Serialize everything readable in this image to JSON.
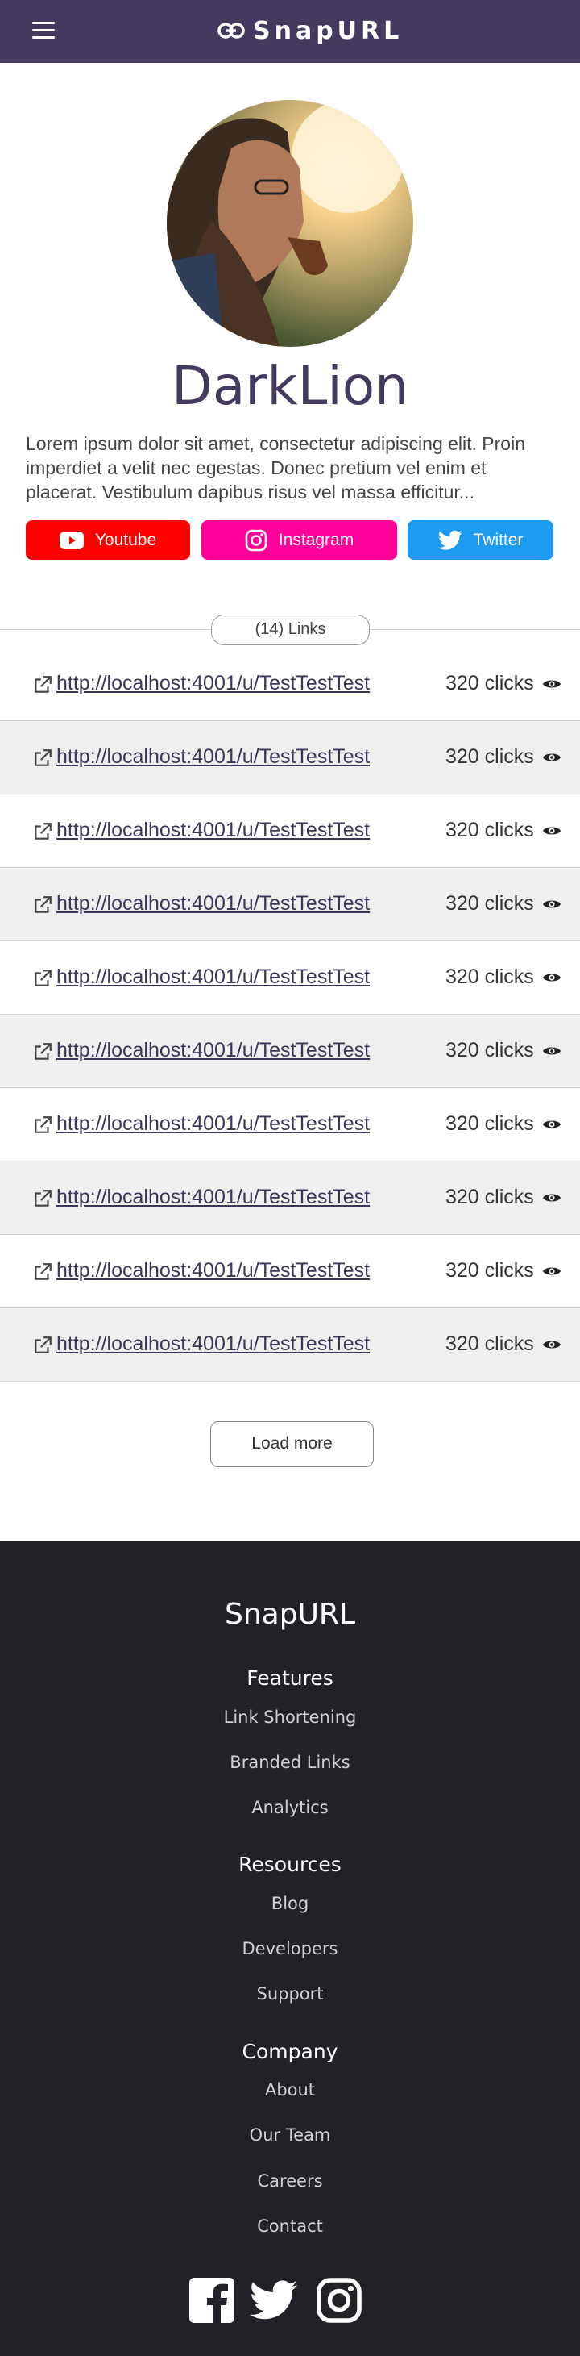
{
  "header": {
    "brand": "SnapURL",
    "menu_icon": "hamburger-menu-icon",
    "brand_icon": "link-icon",
    "background_color": "#44395f"
  },
  "profile": {
    "username": "DarkLion",
    "bio": "Lorem ipsum dolor sit amet, consectetur adipiscing elit. Proin imperdiet a velit nec egestas. Donec pretium vel enim et placerat. Vestibulum dapibus risus vel massa efficitur...",
    "socials": [
      {
        "label": "Youtube",
        "icon": "youtube-icon",
        "color": "#ff0000"
      },
      {
        "label": "Instagram",
        "icon": "instagram-icon",
        "color": "#ff0099"
      },
      {
        "label": "Twitter",
        "icon": "twitter-icon",
        "color": "#1d9bf0"
      }
    ]
  },
  "links": {
    "count_label": "(14) Links",
    "items": [
      {
        "url": "http://localhost:4001/u/TestTestTest",
        "clicks": "320 clicks"
      },
      {
        "url": "http://localhost:4001/u/TestTestTest",
        "clicks": "320 clicks"
      },
      {
        "url": "http://localhost:4001/u/TestTestTest",
        "clicks": "320 clicks"
      },
      {
        "url": "http://localhost:4001/u/TestTestTest",
        "clicks": "320 clicks"
      },
      {
        "url": "http://localhost:4001/u/TestTestTest",
        "clicks": "320 clicks"
      },
      {
        "url": "http://localhost:4001/u/TestTestTest",
        "clicks": "320 clicks"
      },
      {
        "url": "http://localhost:4001/u/TestTestTest",
        "clicks": "320 clicks"
      },
      {
        "url": "http://localhost:4001/u/TestTestTest",
        "clicks": "320 clicks"
      },
      {
        "url": "http://localhost:4001/u/TestTestTest",
        "clicks": "320 clicks"
      },
      {
        "url": "http://localhost:4001/u/TestTestTest",
        "clicks": "320 clicks"
      }
    ],
    "load_more_label": "Load more"
  },
  "footer": {
    "brand": "SnapURL",
    "sections": [
      {
        "heading": "Features",
        "items": [
          "Link Shortening",
          "Branded Links",
          "Analytics"
        ]
      },
      {
        "heading": "Resources",
        "items": [
          "Blog",
          "Developers",
          "Support"
        ]
      },
      {
        "heading": "Company",
        "items": [
          "About",
          "Our Team",
          "Careers",
          "Contact"
        ]
      }
    ],
    "social_icons": [
      "facebook-icon",
      "twitter-icon",
      "instagram-icon"
    ],
    "background_color": "#232127"
  }
}
